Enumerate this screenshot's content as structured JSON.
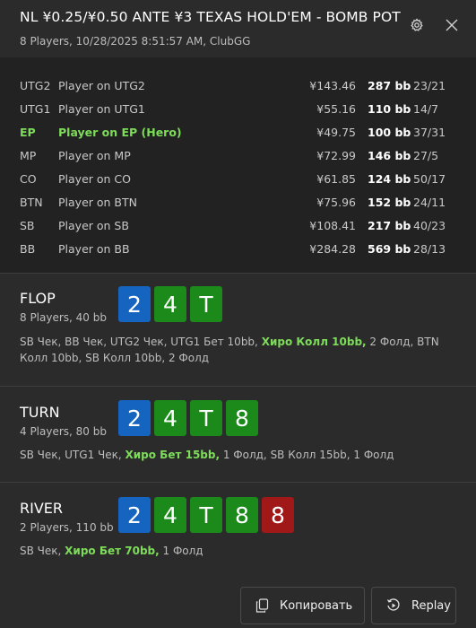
{
  "header": {
    "title": "NL ¥0.25/¥0.50 ANTE ¥3 TEXAS HOLD'EM - BOMB POT",
    "subtitle": "8 Players, 10/28/2025 8:51:57 AM, ClubGG"
  },
  "players": [
    {
      "pos": "UTG2",
      "name": "Player on UTG2",
      "amount": "¥143.46",
      "bb": "287 bb",
      "stat": "23/21",
      "hero": false
    },
    {
      "pos": "UTG1",
      "name": "Player on UTG1",
      "amount": "¥55.16",
      "bb": "110 bb",
      "stat": "14/7",
      "hero": false
    },
    {
      "pos": "EP",
      "name": "Player on EP (Hero)",
      "amount": "¥49.75",
      "bb": "100 bb",
      "stat": "37/31",
      "hero": true
    },
    {
      "pos": "MP",
      "name": "Player on MP",
      "amount": "¥72.99",
      "bb": "146 bb",
      "stat": "27/5",
      "hero": false
    },
    {
      "pos": "CO",
      "name": "Player on CO",
      "amount": "¥61.85",
      "bb": "124 bb",
      "stat": "50/17",
      "hero": false
    },
    {
      "pos": "BTN",
      "name": "Player on BTN",
      "amount": "¥75.96",
      "bb": "152 bb",
      "stat": "24/11",
      "hero": false
    },
    {
      "pos": "SB",
      "name": "Player on SB",
      "amount": "¥108.41",
      "bb": "217 bb",
      "stat": "40/23",
      "hero": false
    },
    {
      "pos": "BB",
      "name": "Player on BB",
      "amount": "¥284.28",
      "bb": "569 bb",
      "stat": "28/13",
      "hero": false
    }
  ],
  "streets": {
    "flop": {
      "name": "FLOP",
      "sub": "8 Players, 40 bb",
      "cards": [
        {
          "rank": "2",
          "color": "blue"
        },
        {
          "rank": "4",
          "color": "green"
        },
        {
          "rank": "T",
          "color": "green"
        }
      ],
      "actions_pre": "SB Чек, BB Чек, UTG2 Чек, UTG1 Бет 10bb, ",
      "actions_hero": "Хиро Колл 10bb,",
      "actions_post": " 2 Фолд, BTN Колл 10bb, SB Колл 10bb, 2 Фолд"
    },
    "turn": {
      "name": "TURN",
      "sub": "4 Players, 80 bb",
      "cards": [
        {
          "rank": "2",
          "color": "blue"
        },
        {
          "rank": "4",
          "color": "green"
        },
        {
          "rank": "T",
          "color": "green"
        },
        {
          "rank": "8",
          "color": "green"
        }
      ],
      "actions_pre": "SB Чек, UTG1 Чек, ",
      "actions_hero": "Хиро Бет 15bb,",
      "actions_post": " 1 Фолд, SB Колл 15bb, 1 Фолд"
    },
    "river": {
      "name": "RIVER",
      "sub": "2 Players, 110 bb",
      "cards": [
        {
          "rank": "2",
          "color": "blue"
        },
        {
          "rank": "4",
          "color": "green"
        },
        {
          "rank": "T",
          "color": "green"
        },
        {
          "rank": "8",
          "color": "green"
        },
        {
          "rank": "8",
          "color": "red"
        }
      ],
      "actions_pre": "SB Чек, ",
      "actions_hero": "Хиро Бет 70bb,",
      "actions_post": " 1 Фолд"
    }
  },
  "footer": {
    "copy_label": "Копировать",
    "replay_label": "Replay"
  },
  "icons": {
    "settings": "gear-icon",
    "close": "close-icon",
    "copy": "copy-icon",
    "replay": "replay-icon"
  },
  "colors": {
    "hero_green": "#7ddc5a",
    "card_blue": "#1565c0",
    "card_green": "#1b8a1b",
    "card_red": "#a01818"
  }
}
